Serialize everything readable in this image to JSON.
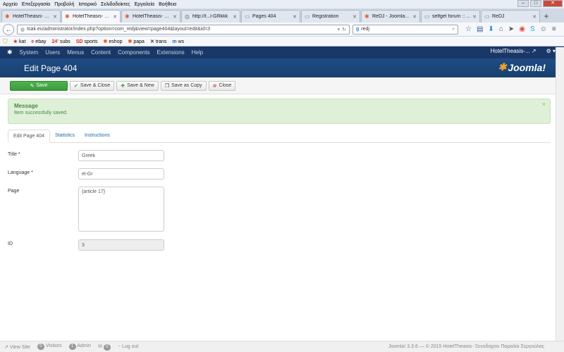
{
  "browser": {
    "menu": [
      "Αρχείο",
      "Επεξεργασία",
      "Προβολή",
      "Ιστορικό",
      "Σελιδοδείκτες",
      "Εργαλεία",
      "Βοήθεια"
    ],
    "tabs": [
      {
        "title": "HotelTheasis- Ξ…",
        "active": false
      },
      {
        "title": "HotelTheasis- Ξ…",
        "active": true
      },
      {
        "title": "HotelTheasis- Ξ…",
        "active": false
      },
      {
        "title": "http://t...l-GRkkk",
        "active": false
      },
      {
        "title": "Pages 404",
        "active": false
      },
      {
        "title": "Registration",
        "active": false
      },
      {
        "title": "ReDJ - Joomla! ...",
        "active": false
      },
      {
        "title": "selfget forum :: ...",
        "active": false
      },
      {
        "title": "ReDJ",
        "active": false
      }
    ],
    "url": "tsak.eu/administrator/index.php?option=com_redj&view=page404&layout=edit&id=3",
    "search_value": "redj",
    "bookmarks": [
      "kat",
      "ebay",
      "subs",
      "sports",
      "eshop",
      "papa",
      "trans",
      "ws"
    ],
    "bookmark_prefixes": [
      "",
      "",
      "24'",
      "SD",
      "",
      "",
      "",
      ""
    ]
  },
  "admin": {
    "menu": [
      "System",
      "Users",
      "Menus",
      "Content",
      "Components",
      "Extensions",
      "Help"
    ],
    "site_name": "HotelTheasis-...",
    "page_title": "Edit Page 404",
    "brand": "Joomla!"
  },
  "toolbar": {
    "save": "Save",
    "save_close": "Save & Close",
    "save_new": "Save & New",
    "save_copy": "Save as Copy",
    "close": "Close"
  },
  "message": {
    "heading": "Message",
    "body": "Item successfully saved."
  },
  "tabs": [
    "Edit Page 404",
    "Statistics",
    "Instructions"
  ],
  "form": {
    "title_label": "Title *",
    "title_value": "Greek",
    "language_label": "Language *",
    "language_value": "el-Gr",
    "page_label": "Page",
    "page_value": "{article 17}",
    "id_label": "ID",
    "id_value": "3"
  },
  "status": {
    "view_site": "View Site",
    "visitors_count": "0",
    "visitors": "Visitors",
    "admin_count": "1",
    "admin": "Admin",
    "messages_count": "0",
    "logout": "Log out",
    "copyright": "Joomla! 3.3.6 — © 2015 HotelTheasis- Ξενοδοχείο Παραλία Σεργούλας"
  }
}
